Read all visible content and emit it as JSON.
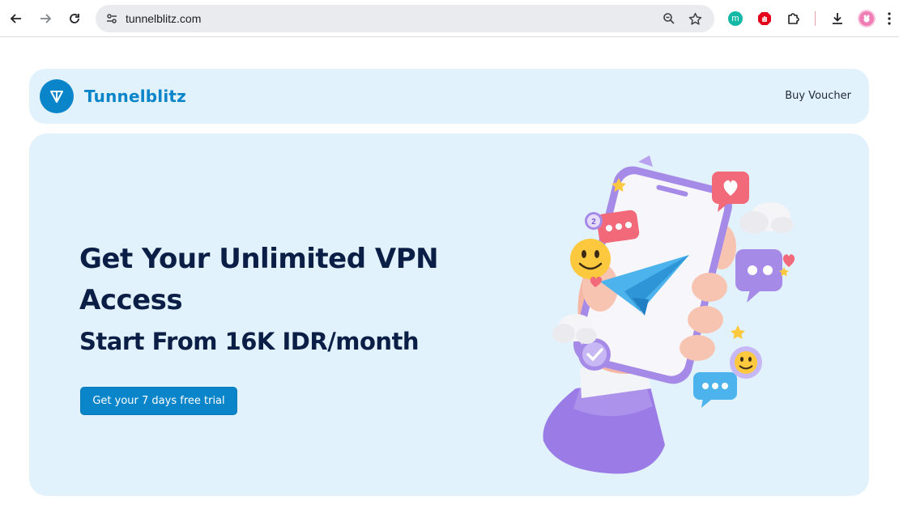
{
  "browser": {
    "url": "tunnelblitz.com",
    "icons": [
      "back-icon",
      "forward-icon",
      "reload-icon",
      "site-settings-icon",
      "zoom-icon",
      "bookmark-star-icon",
      "extension-m-icon",
      "extension-adblock-icon",
      "extensions-puzzle-icon",
      "download-icon",
      "profile-avatar-icon"
    ],
    "extension_m_label": "m"
  },
  "navbar": {
    "brand": "Tunnelblitz",
    "buy_voucher": "Buy Voucher"
  },
  "hero": {
    "headline": "Get Your Unlimited VPN Access",
    "subheadline": "Start From 16K IDR/month",
    "cta": "Get your 7 days free trial",
    "notification_count": "2"
  },
  "colors": {
    "brand_blue": "#0a85c9",
    "hero_bg": "#e2f2fc",
    "heading_navy": "#0b1e46"
  }
}
